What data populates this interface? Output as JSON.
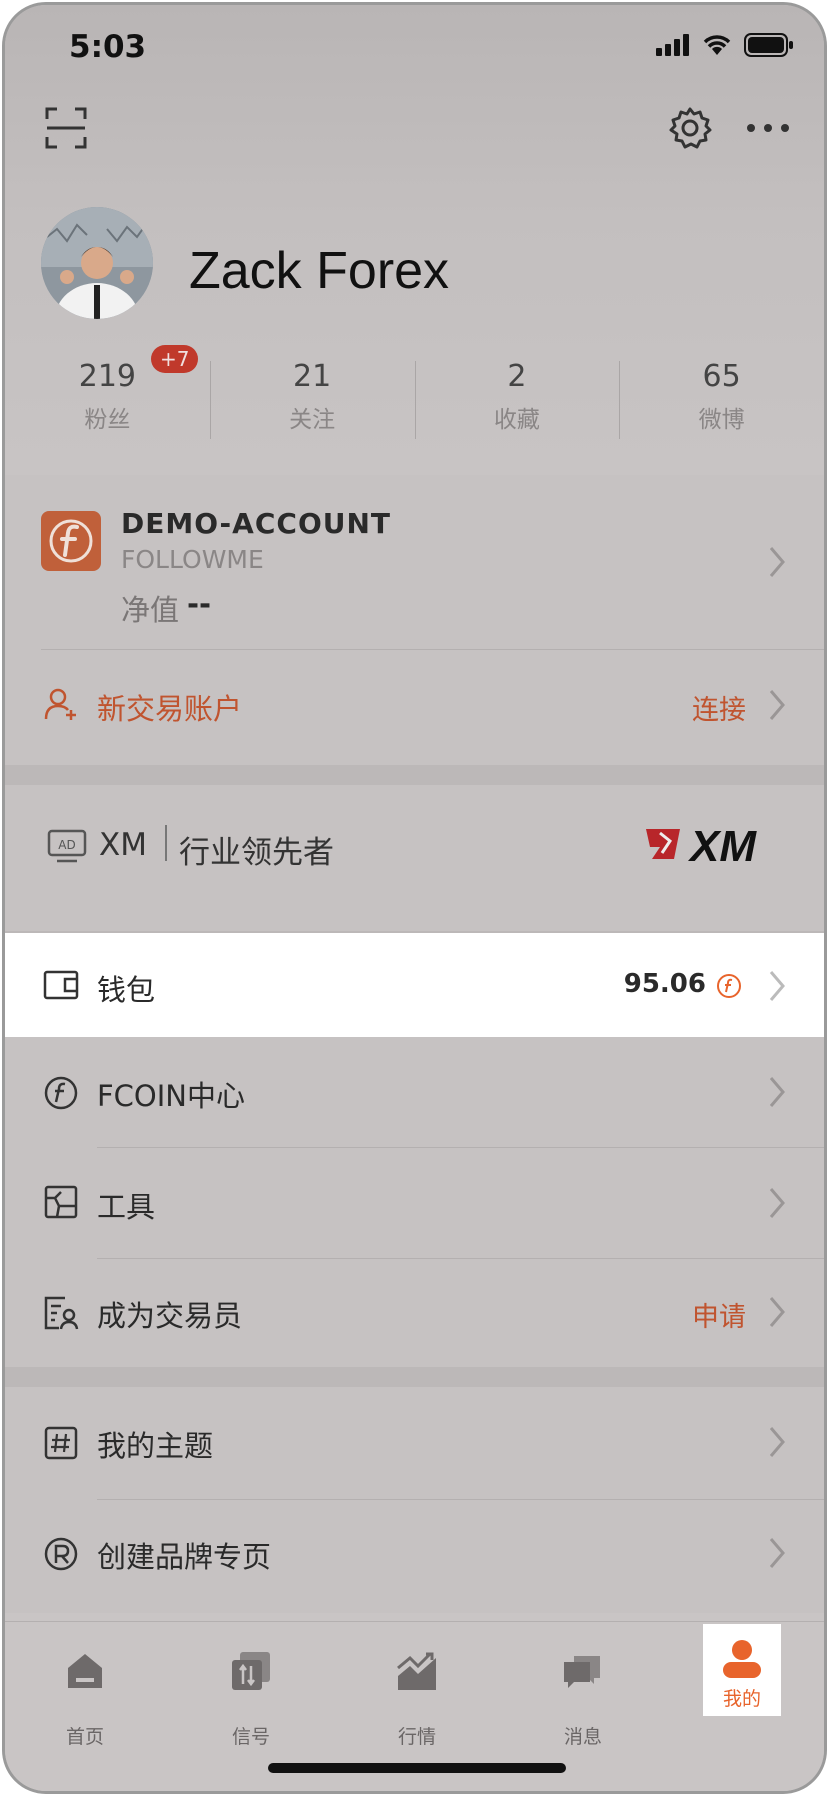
{
  "status_bar": {
    "time": "5:03"
  },
  "profile": {
    "name": "Zack Forex"
  },
  "stats": [
    {
      "value": "219",
      "label": "粉丝",
      "badge": "+7"
    },
    {
      "value": "21",
      "label": "关注"
    },
    {
      "value": "2",
      "label": "收藏"
    },
    {
      "value": "65",
      "label": "微博"
    }
  ],
  "account": {
    "name": "DEMO-ACCOUNT",
    "broker": "FOLLOWME",
    "equity_label": "净值",
    "equity_value": "--"
  },
  "new_account": {
    "label": "新交易账户",
    "action": "连接"
  },
  "ad": {
    "tag": "AD",
    "brand": "XM",
    "slogan": "行业领先者",
    "logo_text": "XM"
  },
  "menu": [
    {
      "label": "钱包",
      "value": "95.06"
    },
    {
      "label": "FCOIN中心"
    },
    {
      "label": "工具"
    },
    {
      "label": "成为交易员",
      "action": "申请"
    },
    {
      "label": "我的主题"
    },
    {
      "label": "创建品牌专页"
    }
  ],
  "tabs": [
    {
      "label": "首页"
    },
    {
      "label": "信号"
    },
    {
      "label": "行情"
    },
    {
      "label": "消息"
    },
    {
      "label": "我的"
    }
  ],
  "colors": {
    "accent": "#e8642c",
    "dim_overlay": "#c6c2c2",
    "highlight": "#ffffff"
  }
}
